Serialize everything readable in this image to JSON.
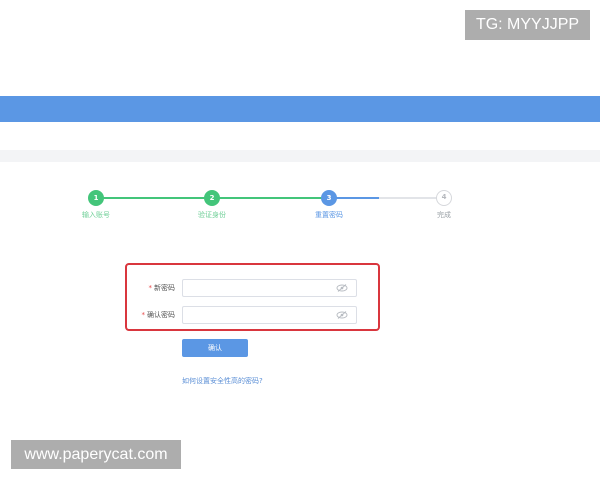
{
  "steps": [
    {
      "number": "1",
      "label": "输入账号",
      "state": "done"
    },
    {
      "number": "2",
      "label": "验证身份",
      "state": "done"
    },
    {
      "number": "3",
      "label": "重置密码",
      "state": "current"
    },
    {
      "number": "4",
      "label": "完成",
      "state": "pending"
    }
  ],
  "form": {
    "new_password_label": "新密码",
    "confirm_password_label": "确认密码",
    "required_mark": "*",
    "new_password_value": "",
    "confirm_password_value": "",
    "confirm_button_label": "确认",
    "help_link_text": "如何设置安全性高的密码?"
  },
  "watermarks": {
    "top": "TG: MYYJJPP",
    "bottom": "www.paperycat.com"
  },
  "colors": {
    "header": "#5b97e4",
    "step_done": "#43c57a",
    "step_current": "#5b97e4",
    "highlight_border": "#d9363e"
  }
}
